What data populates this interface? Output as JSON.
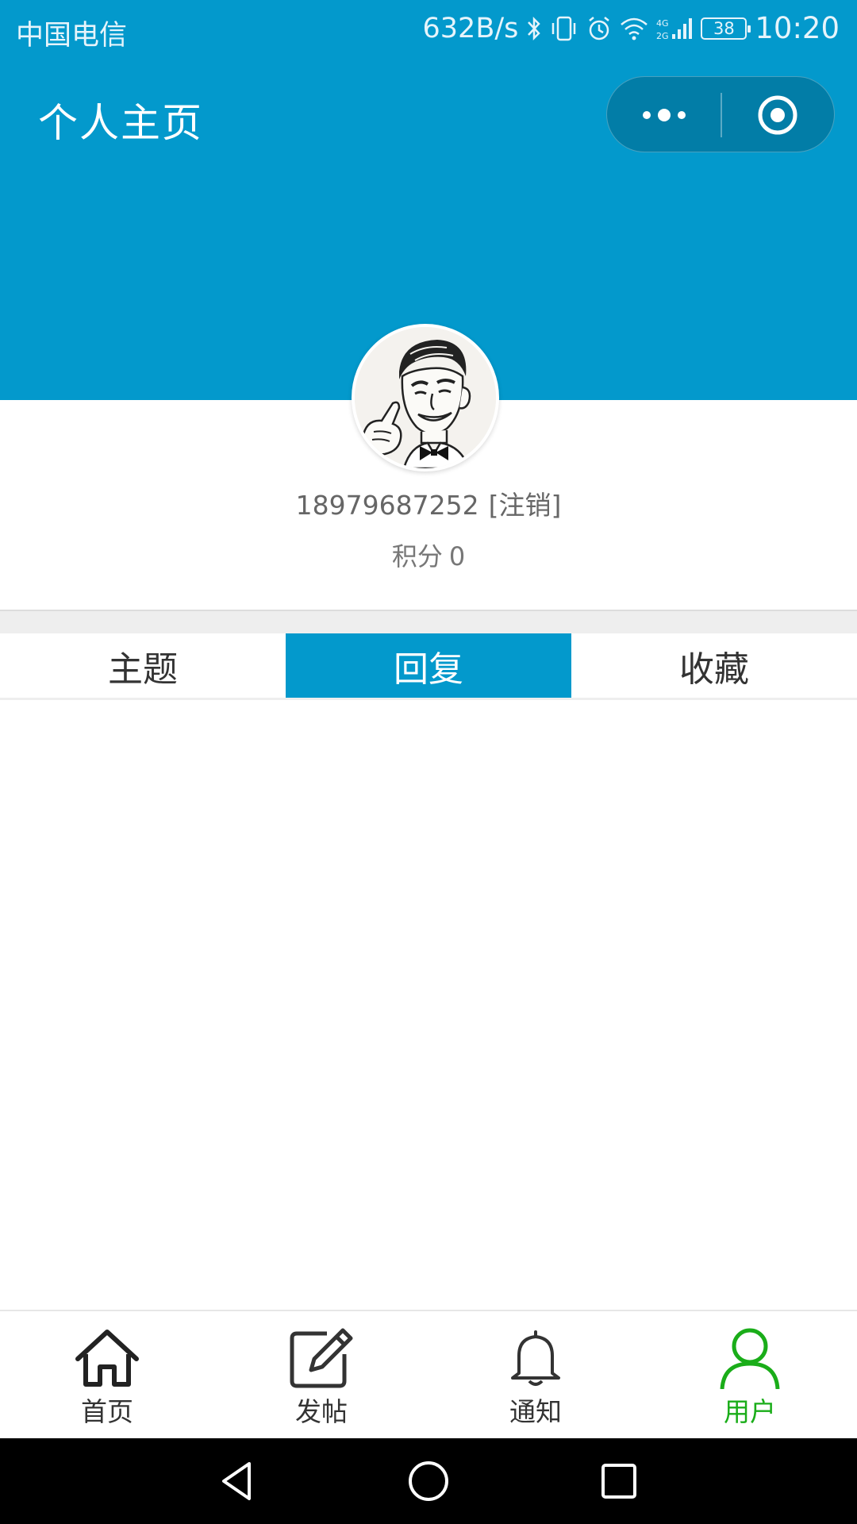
{
  "status_bar": {
    "carrier": "中国电信",
    "net_speed": "632B/s",
    "network_type": "4G 2G",
    "battery": "38",
    "time": "10:20"
  },
  "header": {
    "title": "个人主页",
    "more_icon": "more-dots-icon",
    "close_icon": "target-close-icon"
  },
  "profile": {
    "avatar_icon": "retro-man-avatar",
    "phone": "18979687252",
    "logout_label": "[注销]",
    "points_label": "积分",
    "points_value": "0"
  },
  "tabs": [
    {
      "label": "主题",
      "active": false
    },
    {
      "label": "回复",
      "active": true
    },
    {
      "label": "收藏",
      "active": false
    }
  ],
  "tabbar": {
    "items": [
      {
        "label": "首页",
        "icon": "home-icon",
        "active": false
      },
      {
        "label": "发帖",
        "icon": "edit-icon",
        "active": false
      },
      {
        "label": "通知",
        "icon": "bell-icon",
        "active": false
      },
      {
        "label": "用户",
        "icon": "user-icon",
        "active": true
      }
    ],
    "active_color": "#1aad19"
  },
  "colors": {
    "primary": "#0399cc",
    "tab_active_text": "#ffffff"
  }
}
